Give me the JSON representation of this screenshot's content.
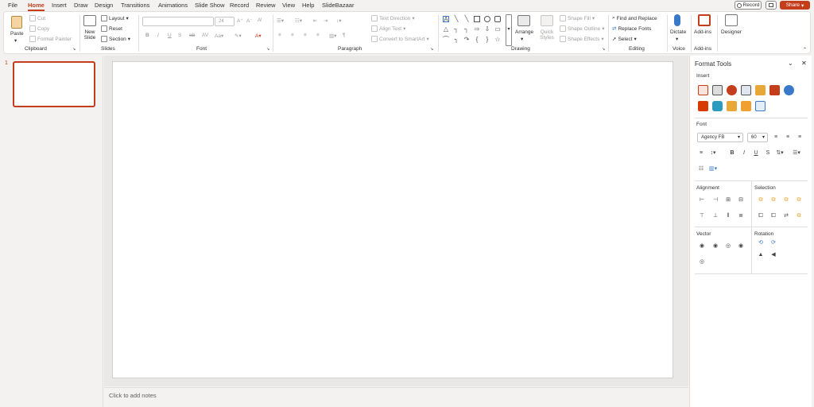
{
  "menu": {
    "tabs": [
      "File",
      "Home",
      "Insert",
      "Draw",
      "Design",
      "Transitions",
      "Animations",
      "Slide Show",
      "Record",
      "Review",
      "View",
      "Help",
      "SlideBazaar"
    ],
    "active": "Home"
  },
  "topright": {
    "record": "Record",
    "share": "Share"
  },
  "clipboard": {
    "paste": "Paste",
    "cut": "Cut",
    "copy": "Copy",
    "format_painter": "Format Painter",
    "label": "Clipboard"
  },
  "slides": {
    "new_slide": "New Slide",
    "layout": "Layout",
    "reset": "Reset",
    "section": "Section",
    "label": "Slides"
  },
  "font": {
    "name": "",
    "size": "24",
    "label": "Font"
  },
  "paragraph": {
    "text_direction": "Text Direction",
    "align_text": "Align Text",
    "smartart": "Convert to SmartArt",
    "label": "Paragraph"
  },
  "drawing": {
    "arrange": "Arrange",
    "quick_styles": "Quick Styles",
    "shape_fill": "Shape Fill",
    "shape_outline": "Shape Outline",
    "shape_effects": "Shape Effects",
    "label": "Drawing"
  },
  "editing": {
    "find_replace": "Find and Replace",
    "replace_fonts": "Replace Fonts",
    "select": "Select",
    "label": "Editing"
  },
  "voice": {
    "dictate": "Dictate",
    "label": "Voice"
  },
  "addins": {
    "addins": "Add-ins",
    "label": "Add-ins"
  },
  "designer": {
    "designer": "Designer"
  },
  "thumbnails": {
    "slide_number": "1"
  },
  "notes": {
    "placeholder": "Click to add notes"
  },
  "pane": {
    "title": "Format Tools",
    "insert": "Insert",
    "font": "Font",
    "font_name": "Agency FB",
    "font_size": "60",
    "alignment": "Alignment",
    "selection": "Selection",
    "vector": "Vector",
    "rotation": "Rotation"
  },
  "colors": {
    "accent": "#c43e1c"
  }
}
